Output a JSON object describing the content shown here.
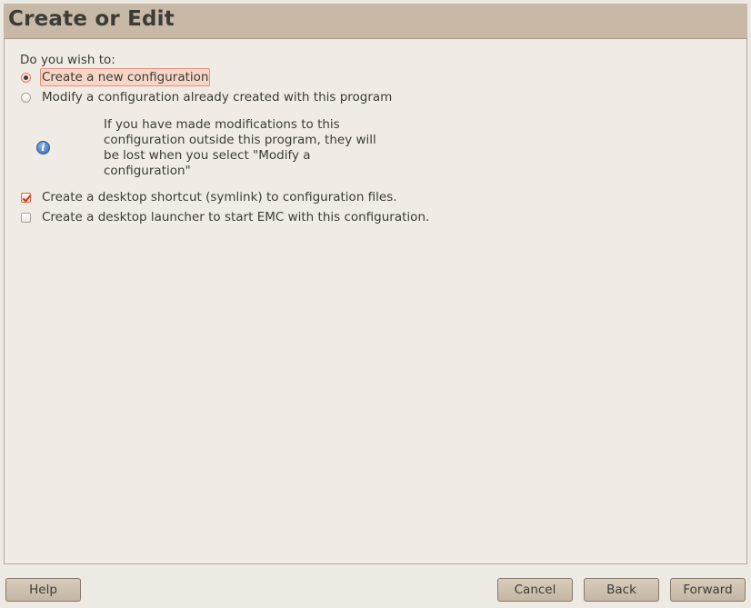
{
  "header": {
    "title": "Create or Edit"
  },
  "main": {
    "question": "Do you wish to:",
    "options": [
      {
        "label": "Create a new configuration",
        "selected": true
      },
      {
        "label": "Modify a configuration already created with this program",
        "selected": false
      }
    ],
    "info_text": "If you have made modifications to this configuration outside this program, they will be lost when you select \"Modify a configuration\"",
    "checkboxes": [
      {
        "label": "Create a desktop shortcut (symlink) to configuration files.",
        "checked": true
      },
      {
        "label": "Create a desktop launcher to start EMC with this configuration.",
        "checked": false
      }
    ]
  },
  "buttons": {
    "help": "Help",
    "cancel": "Cancel",
    "back": "Back",
    "forward": "Forward"
  },
  "icons": {
    "info": "info-icon"
  },
  "colors": {
    "header_bg": "#c7b9a6",
    "window_bg": "#ede9e3",
    "accent": "#e07a5f"
  }
}
